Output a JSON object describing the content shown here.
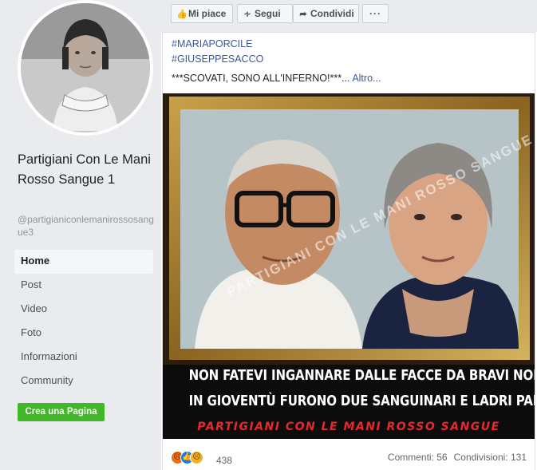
{
  "page": {
    "name": "Partigiani Con Le Mani Rosso Sangue 1",
    "handle": "@partigianiconlemanirossosangue3"
  },
  "nav": [
    {
      "label": "Home",
      "active": true
    },
    {
      "label": "Post"
    },
    {
      "label": "Video"
    },
    {
      "label": "Foto"
    },
    {
      "label": "Informazioni"
    },
    {
      "label": "Community"
    }
  ],
  "create_page_label": "Crea una Pagina",
  "actions": {
    "like": "Mi piace",
    "follow": "Segui",
    "share": "Condividi",
    "more": "···"
  },
  "post": {
    "hashtags": [
      "#MARIAPORCILE",
      "#GIUSEPPESACCO"
    ],
    "text": "***SCOVATI, SONO ALL'INFERNO!***...",
    "more_link": "Altro...",
    "image": {
      "watermark": "PARTIGIANI CON LE MANI ROSSO SANGUE",
      "headline_1": "NON FATEVI INGANNARE DALLE FACCE DA BRAVI NONNETTI",
      "headline_2": "IN GIOVENTÙ FURONO DUE SANGUINARI E LADRI PARTIGIANI",
      "headline_3": "PARTIGIANI CON LE MANI ROSSO SANGUE"
    },
    "reactions": {
      "icons": [
        "angry-icon",
        "like-icon",
        "sad-icon"
      ],
      "count": "438"
    },
    "comments": "Commenti: 56",
    "shares": "Condivisioni: 131"
  },
  "colors": {
    "sidebar_bg": "#e9ebee",
    "link": "#385898",
    "create_button": "#42b72a",
    "headline_red": "#e8282c"
  }
}
